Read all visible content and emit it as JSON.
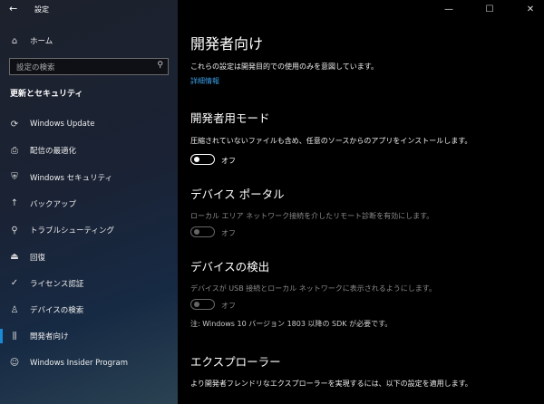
{
  "window": {
    "title": "設定",
    "back": "←",
    "minimize": "—",
    "maximize": "☐",
    "close": "✕"
  },
  "sidebar": {
    "home": "ホーム",
    "search_placeholder": "設定の検索",
    "section": "更新とセキュリティ",
    "items": [
      {
        "label": "Windows Update",
        "icon": "⟳"
      },
      {
        "label": "配信の最適化",
        "icon": "⎙"
      },
      {
        "label": "Windows セキュリティ",
        "icon": "⛨"
      },
      {
        "label": "バックアップ",
        "icon": "↑"
      },
      {
        "label": "トラブルシューティング",
        "icon": "⚲"
      },
      {
        "label": "回復",
        "icon": "⏏"
      },
      {
        "label": "ライセンス認証",
        "icon": "✓"
      },
      {
        "label": "デバイスの検索",
        "icon": "♙"
      },
      {
        "label": "開発者向け",
        "icon": "⫼",
        "selected": true
      },
      {
        "label": "Windows Insider Program",
        "icon": "☺"
      }
    ]
  },
  "main": {
    "title": "開発者向け",
    "intro": "これらの設定は開発目的での使用のみを意図しています。",
    "link": "詳細情報",
    "sections": [
      {
        "heading": "開発者用モード",
        "desc": "圧縮されていないファイルも含め、任意のソースからのアプリをインストールします。",
        "toggle": "オフ"
      },
      {
        "heading": "デバイス ポータル",
        "desc": "ローカル エリア ネットワーク接続を介したリモート診断を有効にします。",
        "toggle": "オフ"
      },
      {
        "heading": "デバイスの検出",
        "desc": "デバイスが USB 接続とローカル ネットワークに表示されるようにします。",
        "toggle": "オフ",
        "note": "注: Windows 10 バージョン 1803 以降の SDK が必要です。"
      },
      {
        "heading": "エクスプローラー",
        "desc": "より開発者フレンドリなエクスプローラーを実現するには、以下の設定を適用します。"
      }
    ]
  }
}
